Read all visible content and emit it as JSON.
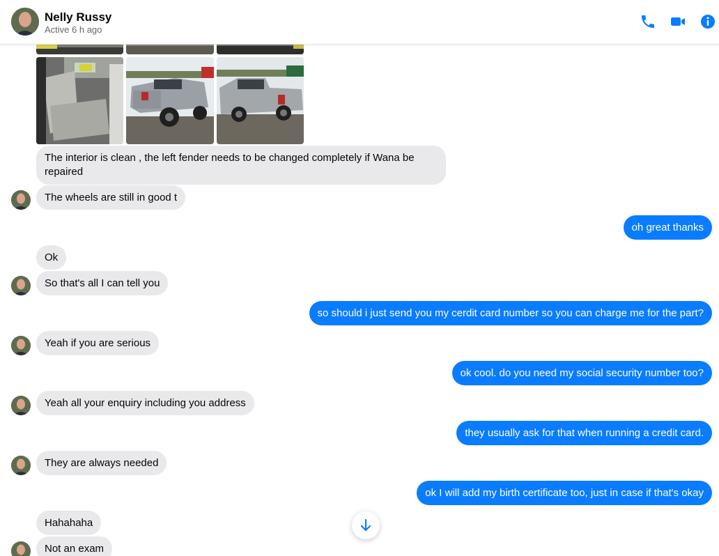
{
  "contact": {
    "name": "Nelly Russy",
    "status": "Active 6 h ago"
  },
  "header_icons": [
    "phone-icon",
    "video-camera-icon",
    "info-icon"
  ],
  "colors": {
    "accent": "#0a7cff",
    "incoming_bubble": "#e9e9eb"
  },
  "messages": [
    {
      "from": "contact",
      "text": "The interior is clean , the left fender  needs to be changed completely if Wana be repaired"
    },
    {
      "from": "contact",
      "text": "The wheels are still in good t"
    },
    {
      "from": "me",
      "text": "oh great thanks"
    },
    {
      "from": "contact",
      "text": "Ok"
    },
    {
      "from": "contact",
      "text": "So that's all I can tell you"
    },
    {
      "from": "me",
      "text": "so should i just send you my cerdit card number so you can charge me for the part?"
    },
    {
      "from": "contact",
      "text": "Yeah if you are serious"
    },
    {
      "from": "me",
      "text": "ok cool. do you need my social security number too?"
    },
    {
      "from": "contact",
      "text": "Yeah all your enquiry including you address"
    },
    {
      "from": "me",
      "text": "they usually ask for that when running a credit card."
    },
    {
      "from": "contact",
      "text": "They are always needed"
    },
    {
      "from": "me",
      "text": "ok I will add my birth certificate too, just in case if that's okay"
    },
    {
      "from": "contact",
      "text": "Hahahaha"
    },
    {
      "from": "contact",
      "text": "Not an exam"
    }
  ]
}
